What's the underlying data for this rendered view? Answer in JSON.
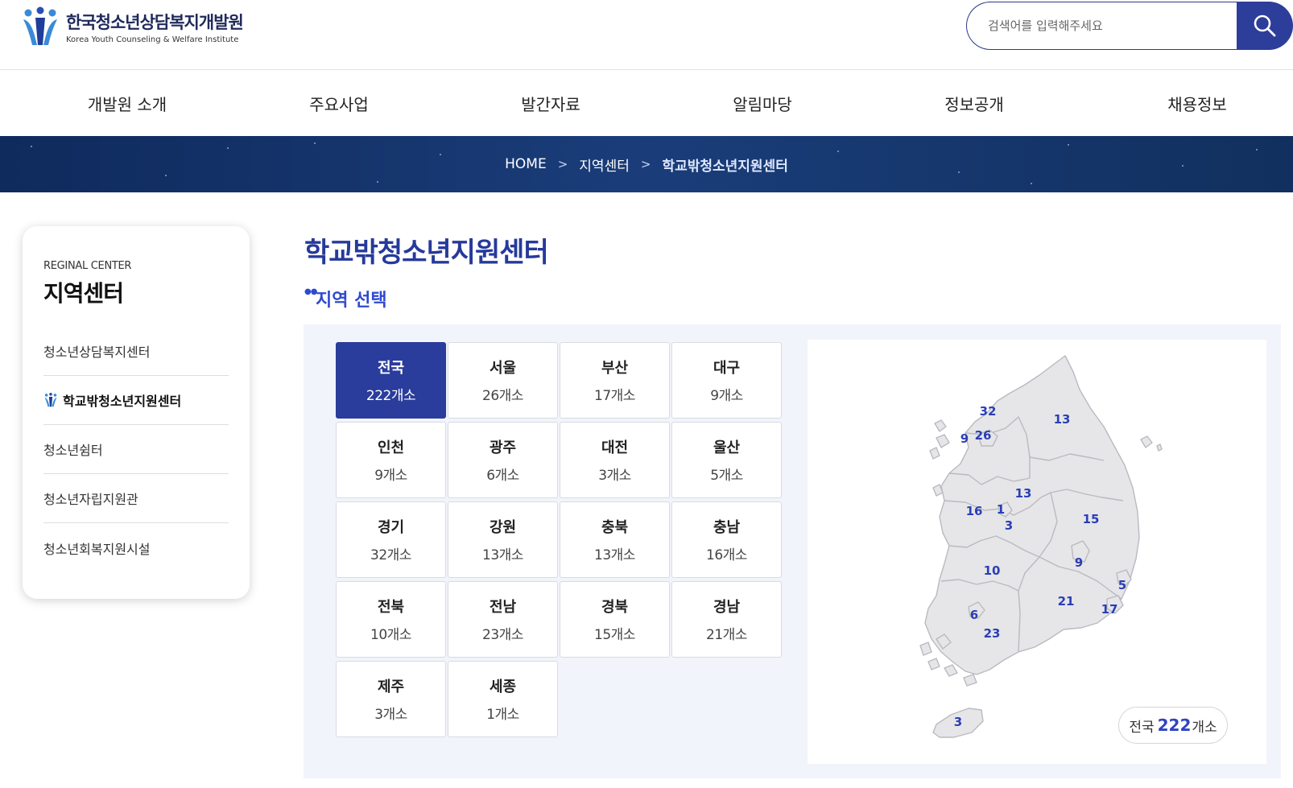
{
  "header": {
    "logo_ko": "한국청소년상담복지개발원",
    "logo_en": "Korea Youth Counseling & Welfare Institute",
    "search_placeholder": "검색어를 입력해주세요",
    "brand_color": "#2d3d9a"
  },
  "nav": [
    "개발원 소개",
    "주요사업",
    "발간자료",
    "알림마당",
    "정보공개",
    "채용정보"
  ],
  "breadcrumb": {
    "home": "HOME",
    "level1": "지역센터",
    "current": "학교밖청소년지원센터"
  },
  "sidebar": {
    "en_title": "REGINAL CENTER",
    "ko_title": "지역센터",
    "items": [
      "청소년상담복지센터",
      "학교밖청소년지원센터",
      "청소년쉼터",
      "청소년자립지원관",
      "청소년회복지원시설"
    ],
    "active_index": 1
  },
  "page": {
    "title": "학교밖청소년지원센터",
    "section": "지역 선택"
  },
  "regions": [
    {
      "name": "전국",
      "count": "222개소",
      "active": true
    },
    {
      "name": "서울",
      "count": "26개소"
    },
    {
      "name": "부산",
      "count": "17개소"
    },
    {
      "name": "대구",
      "count": "9개소"
    },
    {
      "name": "인천",
      "count": "9개소"
    },
    {
      "name": "광주",
      "count": "6개소"
    },
    {
      "name": "대전",
      "count": "3개소"
    },
    {
      "name": "울산",
      "count": "5개소"
    },
    {
      "name": "경기",
      "count": "32개소"
    },
    {
      "name": "강원",
      "count": "13개소"
    },
    {
      "name": "충북",
      "count": "13개소"
    },
    {
      "name": "충남",
      "count": "16개소"
    },
    {
      "name": "전북",
      "count": "10개소"
    },
    {
      "name": "전남",
      "count": "23개소"
    },
    {
      "name": "경북",
      "count": "15개소"
    },
    {
      "name": "경남",
      "count": "21개소"
    },
    {
      "name": "제주",
      "count": "3개소"
    },
    {
      "name": "세종",
      "count": "1개소"
    }
  ],
  "map": {
    "labels": [
      "32",
      "26",
      "9",
      "13",
      "13",
      "16",
      "1",
      "3",
      "15",
      "9",
      "10",
      "5",
      "21",
      "17",
      "6",
      "23",
      "3"
    ],
    "total_prefix": "전국",
    "total_num": "222",
    "total_suffix": "개소"
  }
}
